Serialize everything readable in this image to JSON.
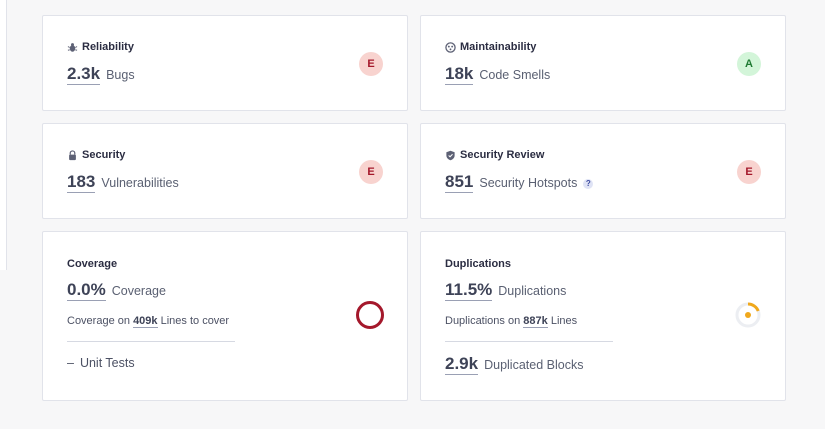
{
  "reliability": {
    "title": "Reliability",
    "value": "2.3k",
    "label": "Bugs",
    "rating": "E"
  },
  "maintainability": {
    "title": "Maintainability",
    "value": "18k",
    "label": "Code Smells",
    "rating": "A"
  },
  "security": {
    "title": "Security",
    "value": "183",
    "label": "Vulnerabilities",
    "rating": "E"
  },
  "security_review": {
    "title": "Security Review",
    "value": "851",
    "label": "Security Hotspots",
    "help": "?",
    "rating": "E"
  },
  "coverage": {
    "title": "Coverage",
    "value": "0.0%",
    "label": "Coverage",
    "sub_prefix": "Coverage on",
    "sub_value": "409k",
    "sub_suffix": "Lines to cover",
    "unit_dash": "–",
    "unit_tests": "Unit Tests"
  },
  "duplications": {
    "title": "Duplications",
    "value": "11.5%",
    "label": "Duplications",
    "sub_prefix": "Duplications on",
    "sub_value": "887k",
    "sub_suffix": "Lines",
    "blocks_value": "2.9k",
    "blocks_label": "Duplicated Blocks"
  },
  "colors": {
    "rating_e_bg": "#f8d3cf",
    "rating_a_bg": "#d3f5d9",
    "coverage_ring": "#a4182b",
    "duplication_gauge": "#f0a81c"
  }
}
